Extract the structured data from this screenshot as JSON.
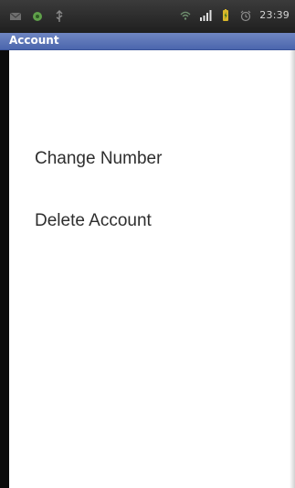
{
  "status_bar": {
    "time": "23:39",
    "icons": [
      "mail-icon",
      "app-icon",
      "usb-icon",
      "wifi-icon",
      "signal-icon",
      "battery-icon",
      "alarm-icon"
    ]
  },
  "title_bar": {
    "title": "Account"
  },
  "menu": {
    "items": [
      {
        "label": "Change Number"
      },
      {
        "label": "Delete Account"
      }
    ]
  }
}
